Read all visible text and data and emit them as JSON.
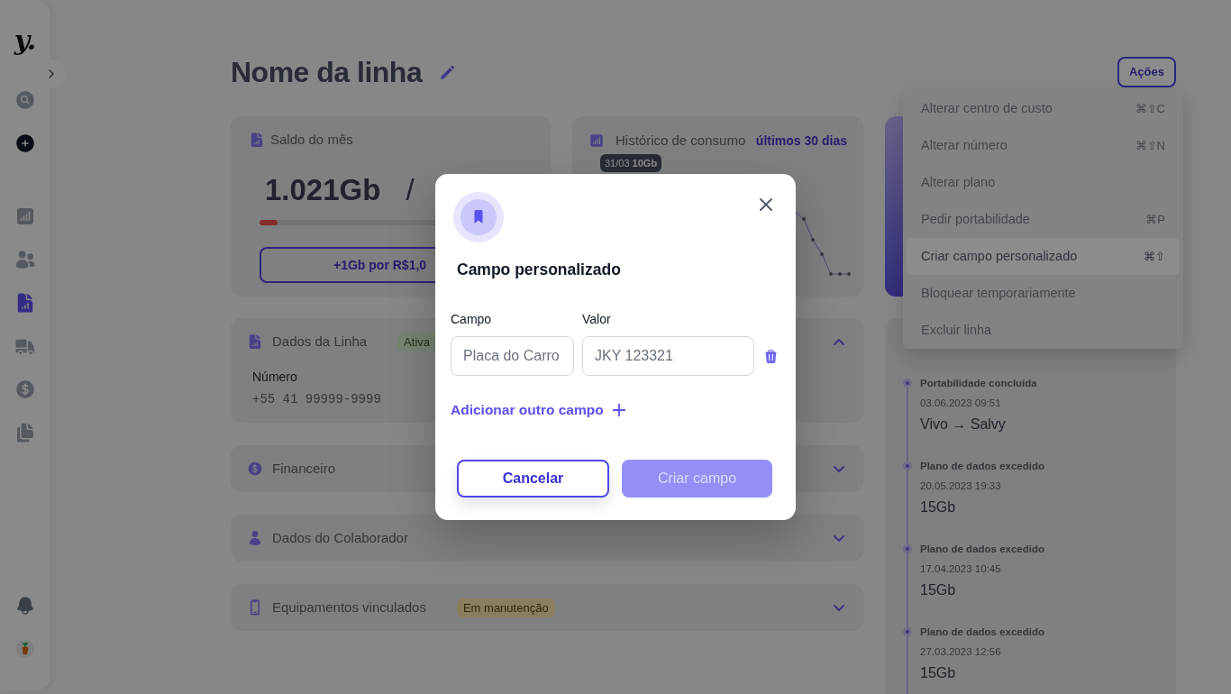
{
  "sidebar": {
    "logo": "y.",
    "nav_items": [
      {
        "selected": false
      },
      {
        "selected": false
      },
      {
        "selected": true
      },
      {
        "selected": false
      },
      {
        "selected": false
      },
      {
        "selected": false
      }
    ]
  },
  "header": {
    "title": "Nome da linha",
    "actions_button": "Ações"
  },
  "actions_menu": {
    "items": [
      {
        "label": "Alterar centro de custo",
        "shortcut": "⌘⇧C",
        "selected": false
      },
      {
        "label": "Alterar número",
        "shortcut": "⌘⇧N",
        "selected": false
      },
      {
        "label": "Alterar plano",
        "selected": false
      },
      {
        "label": "Pedir portabilidade",
        "shortcut": "⌘P",
        "selected": false
      },
      {
        "label": "Criar campo personalizado",
        "shortcut": "⌘⇧",
        "selected": true
      },
      {
        "label": "Bloquear temporariamente",
        "selected": false
      },
      {
        "label": "Excluir linha",
        "selected": false
      }
    ]
  },
  "balance_card": {
    "title": "Saldo do mês",
    "used": "1.021Gb",
    "separator": "/",
    "usage": {
      "level": 0.1
    },
    "button": "+1Gb por R$1,0"
  },
  "history_card": {
    "title": "Histórico de consumo",
    "period": "últimos 30 dias",
    "tooltip": "31/03 **10Gb**"
  },
  "sections": [
    {
      "title": "Dados da Linha",
      "badge": {
        "label": "Ativa",
        "kind": "success"
      },
      "expanded": true,
      "fields": [
        {
          "label": "Número",
          "value": "+55 41 99999-9999"
        }
      ]
    },
    {
      "title": "Financeiro",
      "expanded": false
    },
    {
      "title": "Dados do Colaborador",
      "expanded": false
    },
    {
      "title": "Equipamentos vinculados",
      "badge": {
        "label": "Em manutenção",
        "kind": "warning"
      },
      "expanded": false
    }
  ],
  "timeline": {
    "events": [
      {
        "title": "Portabilidade concluída",
        "date": "03.06.2023 09:51",
        "detail": "Vivo → Salvy"
      },
      {
        "title": "Plano de dados excedido",
        "date": "20.05.2023 19:33",
        "detail": "15Gb"
      },
      {
        "title": "Plano de dados excedido",
        "date": "17.04.2023 10:45",
        "detail": "15Gb"
      },
      {
        "title": "Plano de dados excedido",
        "date": "27.03.2023 12:56",
        "detail": "15Gb"
      }
    ]
  },
  "modal": {
    "title": "Campo personalizado",
    "columns": [
      "Campo",
      "Valor"
    ],
    "rows": [
      {
        "cells": [
          {
            "placeholder": "Placa do Carro"
          },
          {
            "placeholder": "JKY 123321"
          }
        ]
      }
    ],
    "add_link": "Adicionar outro campo",
    "cancel_button": "Cancelar",
    "submit_button": {
      "label": "Criar campo",
      "disabled": true
    }
  }
}
